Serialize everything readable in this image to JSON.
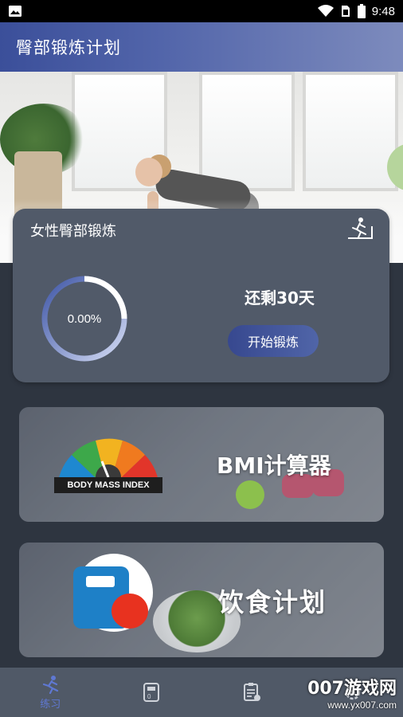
{
  "status_bar": {
    "time": "9:48",
    "icons": [
      "photo-icon",
      "wifi-icon",
      "sim-icon",
      "battery-icon"
    ]
  },
  "app_bar": {
    "title": "臀部锻炼计划"
  },
  "plan_card": {
    "title": "女性臀部锻炼",
    "progress_text": "0.00%",
    "progress_value": 0.0,
    "days_left": "还剩30天",
    "start_button": "开始锻炼"
  },
  "features": {
    "bmi": {
      "label": "BMI计算器",
      "banner": "BODY MASS INDEX"
    },
    "diet": {
      "label": "饮食计划"
    }
  },
  "tab_bar": {
    "tabs": [
      {
        "label": "练习",
        "icon": "running-icon",
        "active": true
      },
      {
        "label": "",
        "icon": "scale-icon",
        "active": false
      },
      {
        "label": "",
        "icon": "clipboard-icon",
        "active": false
      },
      {
        "label": "",
        "icon": "settings-icon",
        "active": false
      }
    ]
  },
  "watermark": {
    "main": "007游戏网",
    "url": "www.yx007.com"
  },
  "colors": {
    "accent": "#4a5fb0",
    "card_bg": "#515a69",
    "page_bg": "#2e3540",
    "tab_active": "#5f78d2"
  }
}
